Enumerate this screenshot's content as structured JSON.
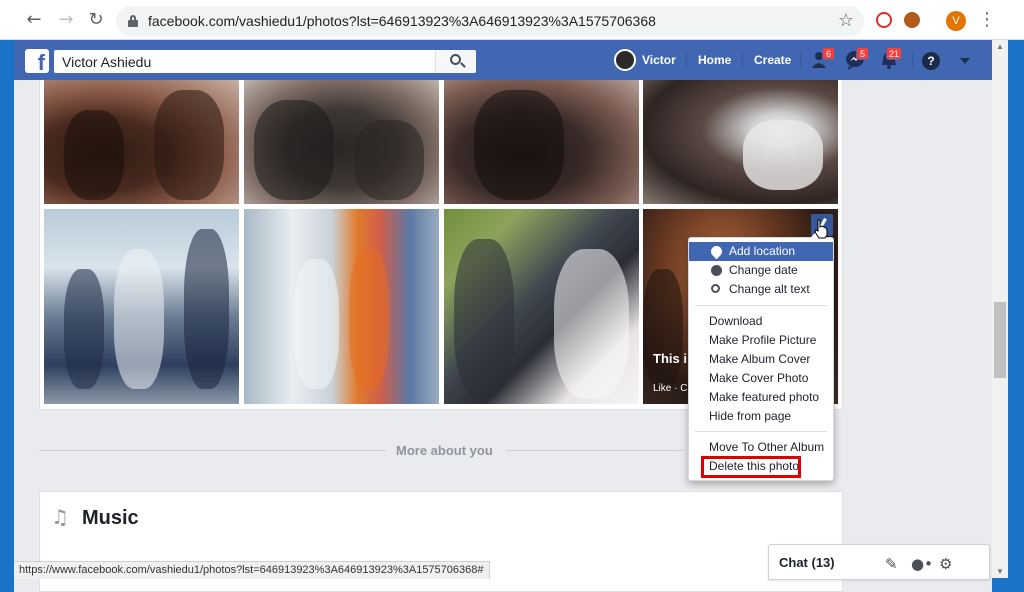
{
  "browser": {
    "url": "facebook.com/vashiedu1/photos?lst=646913923%3A646913923%3A1575706368",
    "profile_initial": "V",
    "icons": [
      "back-icon",
      "forward-icon",
      "reload-icon",
      "lock-icon",
      "bookmark-star-icon",
      "extension-icon",
      "kebab-menu-icon"
    ]
  },
  "fb_header": {
    "logo": "f",
    "search_value": "Victor Ashiedu",
    "user_name": "Victor",
    "home_label": "Home",
    "create_label": "Create",
    "friend_requests_count": "6",
    "messages_count": "5",
    "notifications_count": "21",
    "help_label": "?",
    "brand_color": "#4267b2"
  },
  "photo_8": {
    "caption": "This i",
    "actions": "Like · C"
  },
  "photo_menu": {
    "items": [
      {
        "label": "Add location",
        "icon": "location-pin-icon",
        "active": true
      },
      {
        "label": "Change date",
        "icon": "clock-icon"
      },
      {
        "label": "Change alt text",
        "icon": "search-icon"
      },
      {
        "label": "Download"
      },
      {
        "label": "Make Profile Picture"
      },
      {
        "label": "Make Album Cover"
      },
      {
        "label": "Make Cover Photo"
      },
      {
        "label": "Make featured photo"
      },
      {
        "label": "Hide from page"
      },
      {
        "label": "Move To Other Album"
      },
      {
        "label": "Delete this photo",
        "highlighted": true
      }
    ],
    "highlight_color": "#e00000"
  },
  "sections": {
    "more_about": "More about you",
    "music_title": "Music"
  },
  "status_bar": {
    "url": "https://www.facebook.com/vashiedu1/photos?lst=646913923%3A646913923%3A1575706368#"
  },
  "chat": {
    "label": "Chat (13)",
    "icons": [
      "compose-icon",
      "new-group-icon",
      "settings-gear-icon"
    ]
  }
}
